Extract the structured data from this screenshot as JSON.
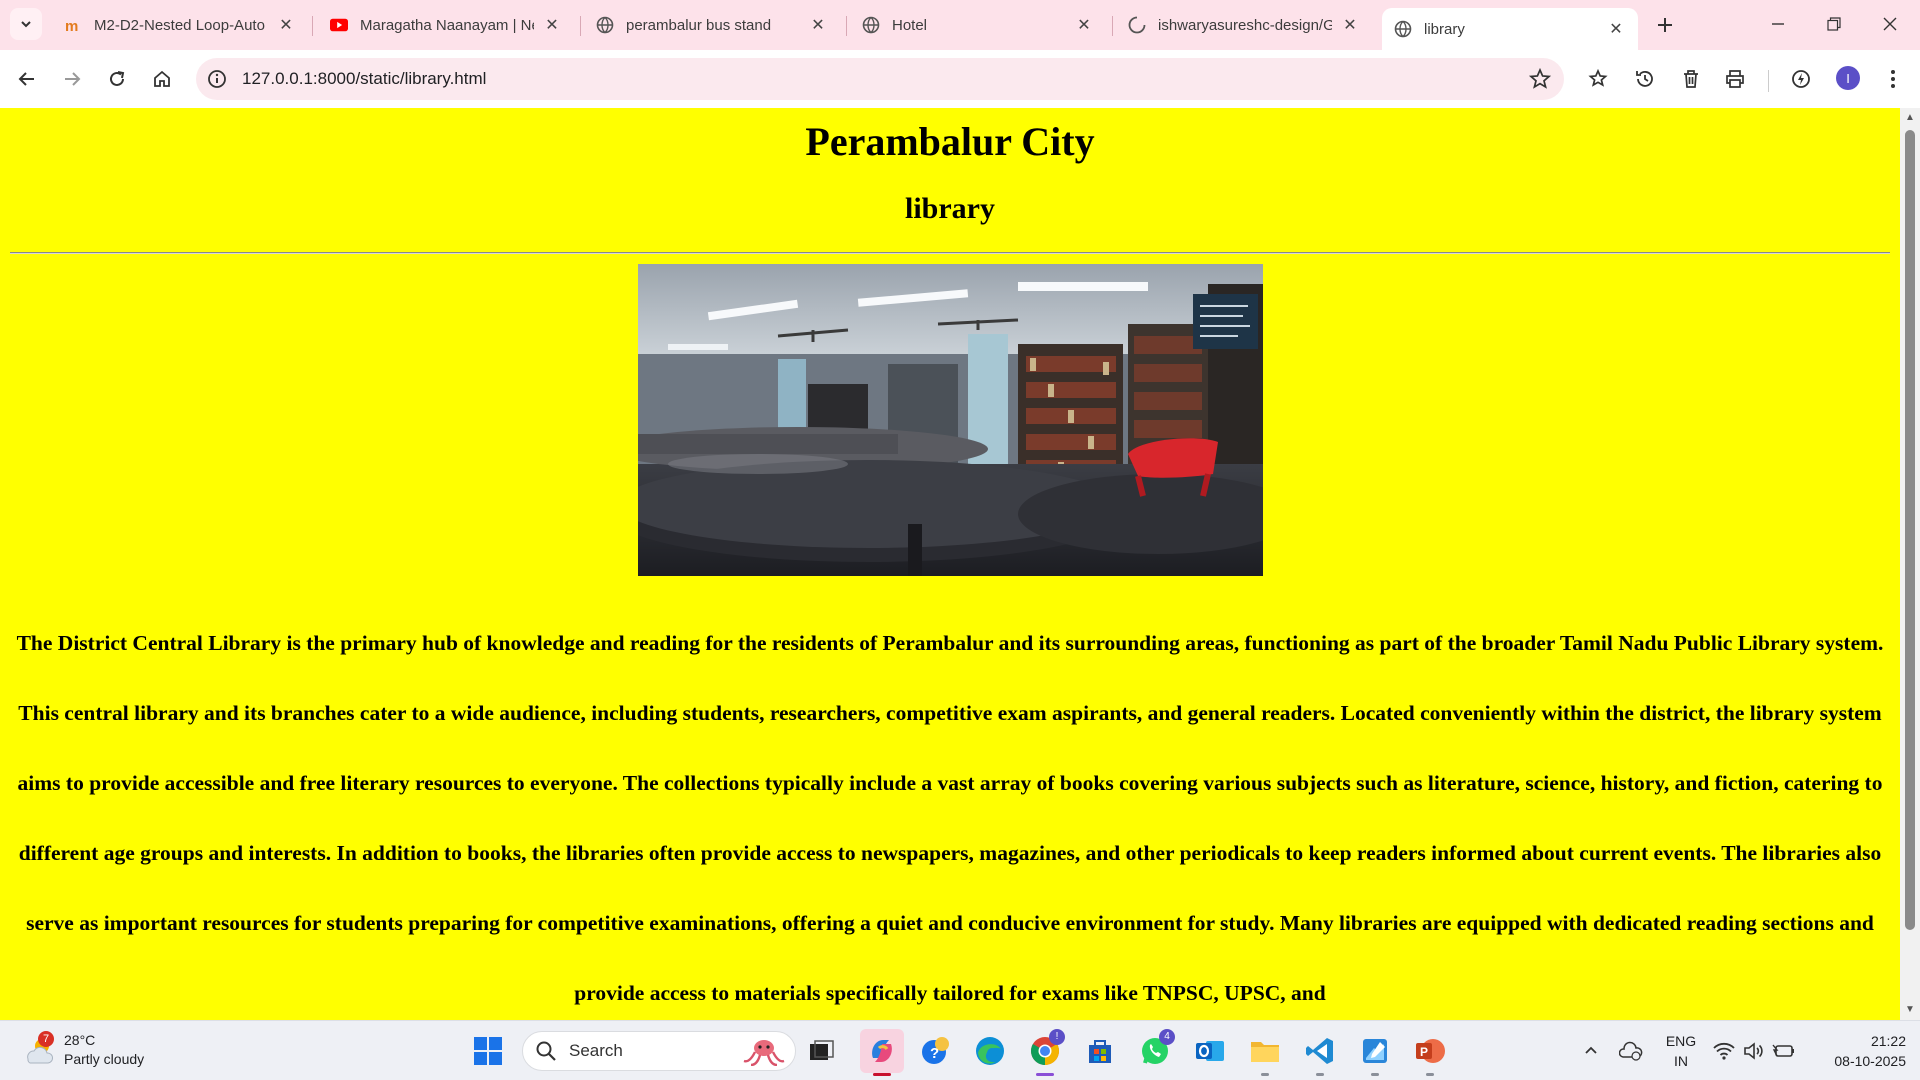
{
  "browser": {
    "tabs": [
      {
        "title": "M2-D2-Nested Loop-Auto",
        "icon": "mindtree-icon",
        "active": false
      },
      {
        "title": "Maragatha Naanayam | Ne",
        "icon": "youtube-icon",
        "active": false
      },
      {
        "title": "perambalur bus stand",
        "icon": "globe-icon",
        "active": false
      },
      {
        "title": "Hotel",
        "icon": "globe-icon",
        "active": false
      },
      {
        "title": "ishwaryasureshc-design/G",
        "icon": "loading-icon",
        "active": false
      },
      {
        "title": "library",
        "icon": "globe-icon",
        "active": true
      }
    ],
    "url": "127.0.0.1:8000/static/library.html",
    "profile_initial": "I"
  },
  "page": {
    "heading": "Perambalur City",
    "subheading": "library",
    "image_alt": "library",
    "body_text": "The District Central Library is the primary hub of knowledge and reading for the residents of Perambalur and its surrounding areas, functioning as part of the broader Tamil Nadu Public Library system. This central library and its branches cater to a wide audience, including students, researchers, competitive exam aspirants, and general readers. Located conveniently within the district, the library system aims to provide accessible and free literary resources to everyone. The collections typically include a vast array of books covering various subjects such as literature, science, history, and fiction, catering to different age groups and interests. In addition to books, the libraries often provide access to newspapers, magazines, and other periodicals to keep readers informed about current events. The libraries also serve as important resources for students preparing for competitive examinations, offering a quiet and conducive environment for study. Many libraries are equipped with dedicated reading sections and provide access to materials specifically tailored for exams like TNPSC, UPSC, and",
    "background_color": "#ffff00"
  },
  "taskbar": {
    "weather": {
      "temp": "28°C",
      "condition": "Partly cloudy",
      "badge": "7"
    },
    "search_label": "Search",
    "chrome_badge": "!",
    "whatsapp_badge": "4",
    "language_line1": "ENG",
    "language_line2": "IN",
    "time": "21:22",
    "date": "08-10-2025"
  }
}
